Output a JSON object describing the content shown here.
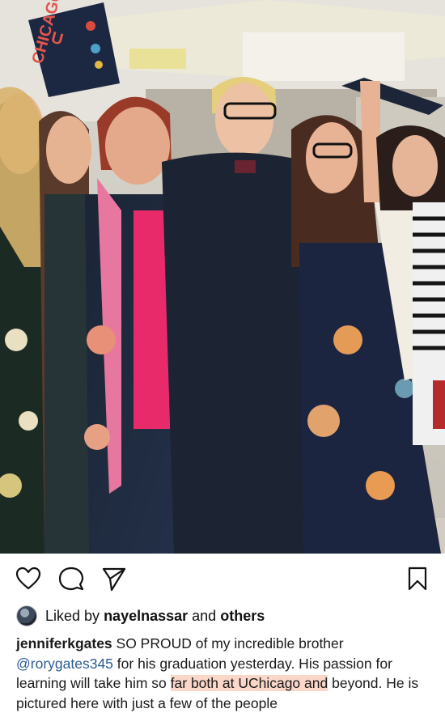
{
  "post": {
    "photo_alt": "Graduation group photo",
    "cap_text_line1": "U",
    "cap_text_line2": "CHICAGO"
  },
  "actions": {
    "like_icon": "heart-icon",
    "comment_icon": "comment-icon",
    "share_icon": "send-icon",
    "save_icon": "bookmark-icon"
  },
  "likes": {
    "prefix": "Liked by",
    "user": "nayelnassar",
    "conjunction": "and",
    "others": "others"
  },
  "caption": {
    "username": "jenniferkgates",
    "text_1": "SO PROUD of my incredible brother",
    "mention": "@rorygates345",
    "text_2": "for his graduation yesterday. His passion for learning will take him so",
    "highlight": "far both at UChicago and",
    "text_3": "beyond. He is pictured here with just a few of the people"
  },
  "colors": {
    "mention": "#2c5c92",
    "highlight": "#fbd7c9",
    "gown": "#1c2433"
  }
}
